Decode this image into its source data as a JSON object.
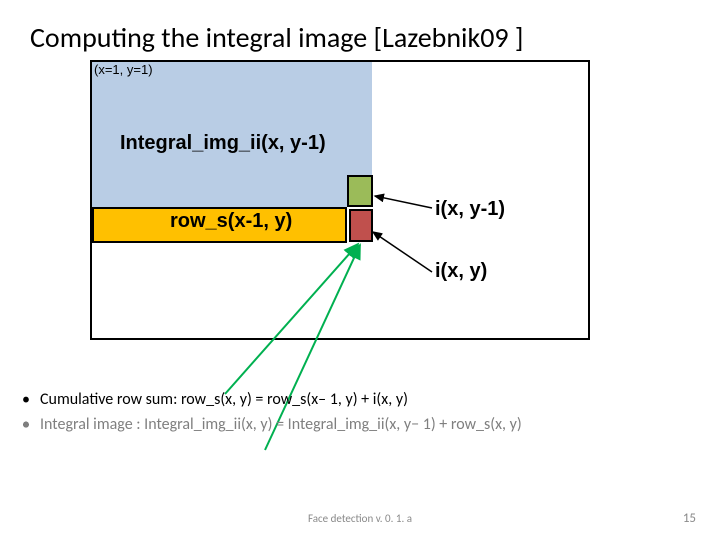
{
  "title": "Computing the integral image [Lazebnik09 ]",
  "diagram": {
    "corner": "(x=1, y=1)",
    "integral_label": "Integral_img_ii(x, y-1)",
    "rows_label": "row_s(x-1, y)",
    "ixy1": "i(x, y-1)",
    "ixy": "i(x, y)"
  },
  "bullets": {
    "b1": "Cumulative row sum: row_s(x, y) = row_s(x– 1, y) + i(x, y)",
    "b2": "",
    "b3": "Integral image : Integral_img_ii(x, y) = Integral_img_ii(x, y− 1) + row_s(x, y)"
  },
  "footer": {
    "center": "Face detection v. 0. 1. a",
    "page": "15"
  }
}
